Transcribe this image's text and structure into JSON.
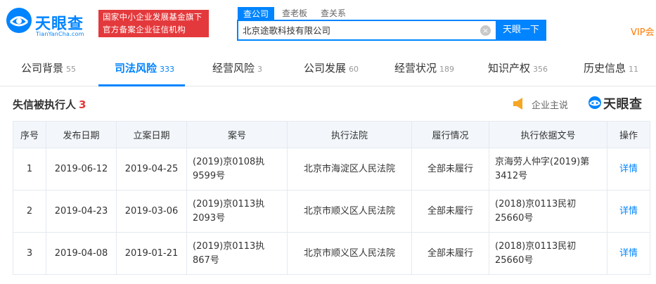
{
  "header": {
    "logo_cn": "天眼查",
    "logo_en": "TianYanCha.com",
    "badge_line1": "国家中小企业发展基金旗下",
    "badge_line2": "官方备案企业征信机构",
    "search_tabs": [
      "查公司",
      "查老板",
      "查关系"
    ],
    "search_value": "北京途歌科技有限公司",
    "clear_glyph": "×",
    "search_button": "天眼一下",
    "vip": "VIP会"
  },
  "nav": {
    "tabs": [
      {
        "label": "公司背景",
        "count": "55"
      },
      {
        "label": "司法风险",
        "count": "333"
      },
      {
        "label": "经营风险",
        "count": "3"
      },
      {
        "label": "公司发展",
        "count": "60"
      },
      {
        "label": "经营状况",
        "count": "189"
      },
      {
        "label": "知识产权",
        "count": "356"
      },
      {
        "label": "历史信息",
        "count": "11"
      }
    ],
    "active_index": 1
  },
  "section": {
    "title": "失信被执行人",
    "count": "3",
    "speak_label": "企业主说",
    "watermark": "天眼查"
  },
  "table": {
    "columns": [
      "序号",
      "发布日期",
      "立案日期",
      "案号",
      "执行法院",
      "履行情况",
      "执行依据文号",
      "操作"
    ],
    "rows": [
      {
        "no": "1",
        "publish": "2019-06-12",
        "filed": "2019-04-25",
        "case_l1": "(2019)京0108执",
        "case_l2": "9599号",
        "court": "北京市海淀区人民法院",
        "status": "全部未履行",
        "basis_l1": "京海劳人仲字(2019)第",
        "basis_l2": "3412号",
        "action": "详情"
      },
      {
        "no": "2",
        "publish": "2019-04-23",
        "filed": "2019-03-06",
        "case_l1": "(2019)京0113执",
        "case_l2": "2093号",
        "court": "北京市顺义区人民法院",
        "status": "全部未履行",
        "basis_l1": "(2018)京0113民初",
        "basis_l2": "25660号",
        "action": "详情"
      },
      {
        "no": "3",
        "publish": "2019-04-08",
        "filed": "2019-01-21",
        "case_l1": "(2019)京0113执",
        "case_l2": "867号",
        "court": "北京市顺义区人民法院",
        "status": "全部未履行",
        "basis_l1": "(2018)京0113民初",
        "basis_l2": "25660号",
        "action": "详情"
      }
    ]
  },
  "colors": {
    "brand_blue": "#0084ff",
    "badge_red": "#e4393c",
    "vip_orange": "#ff7a00",
    "speak_orange": "#f5a623"
  }
}
